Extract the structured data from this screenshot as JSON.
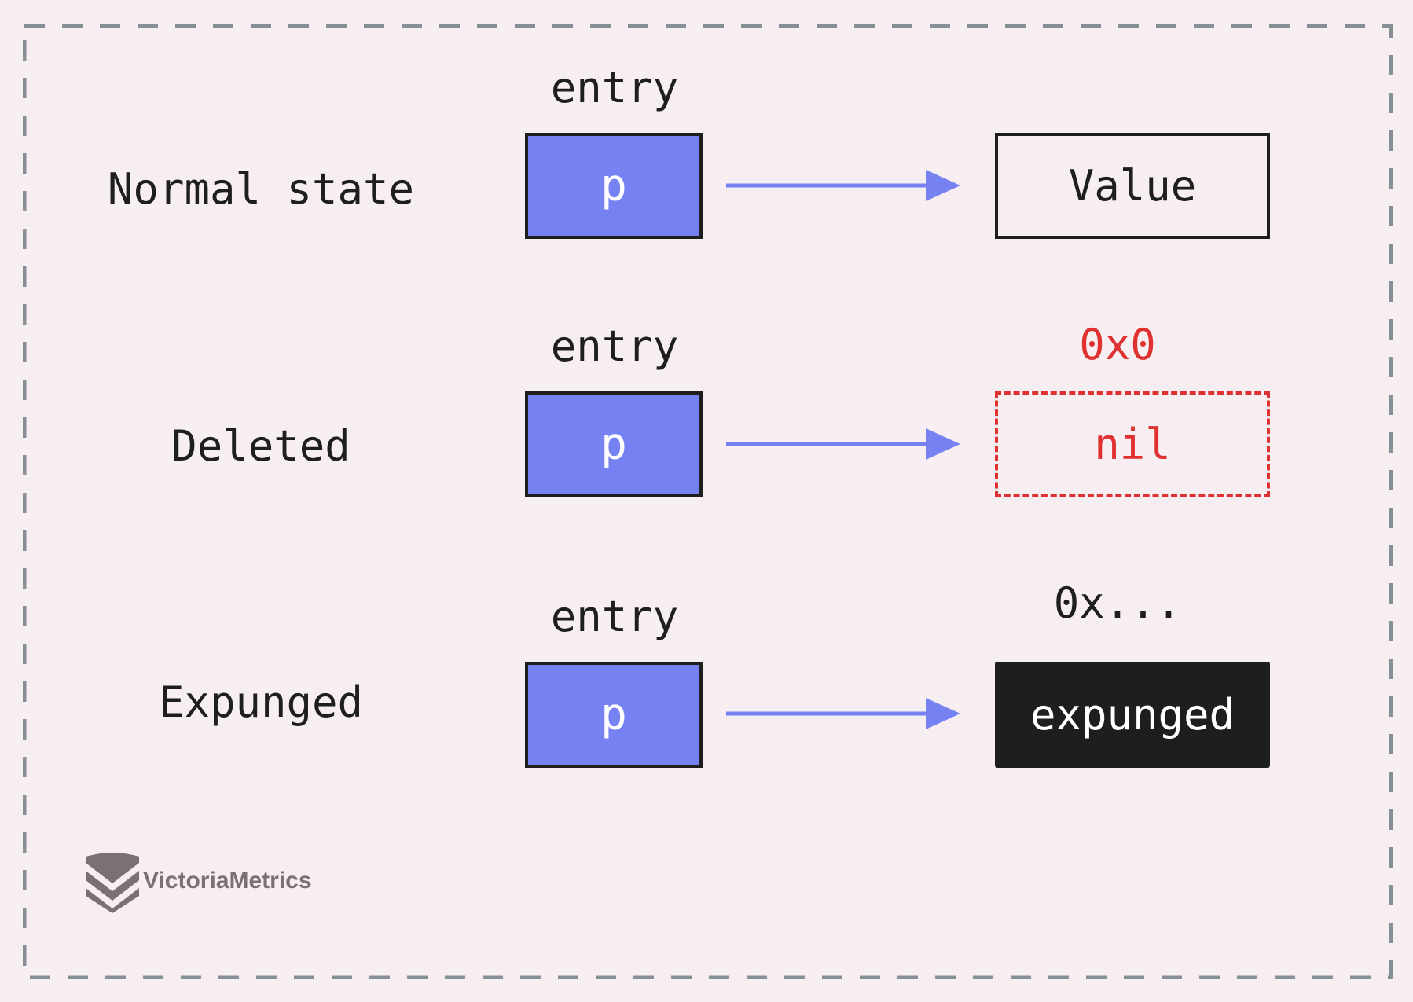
{
  "colors": {
    "background": "#f6eef1",
    "pointer_fill": "#7782f2",
    "arrow": "#7782f2",
    "nil": "#e03131",
    "expunged_fill": "#1e1e1e",
    "frame": "#868e96"
  },
  "rows": [
    {
      "state": "Normal state",
      "entry_label": "entry",
      "pointer": "p",
      "target": "Value",
      "address": ""
    },
    {
      "state": "Deleted",
      "entry_label": "entry",
      "pointer": "p",
      "target": "nil",
      "address": "0x0"
    },
    {
      "state": "Expunged",
      "entry_label": "entry",
      "pointer": "p",
      "target": "expunged",
      "address": "0x..."
    }
  ],
  "logo": {
    "text": "VictoriaMetrics",
    "icon": "victoriametrics-logo-icon"
  }
}
